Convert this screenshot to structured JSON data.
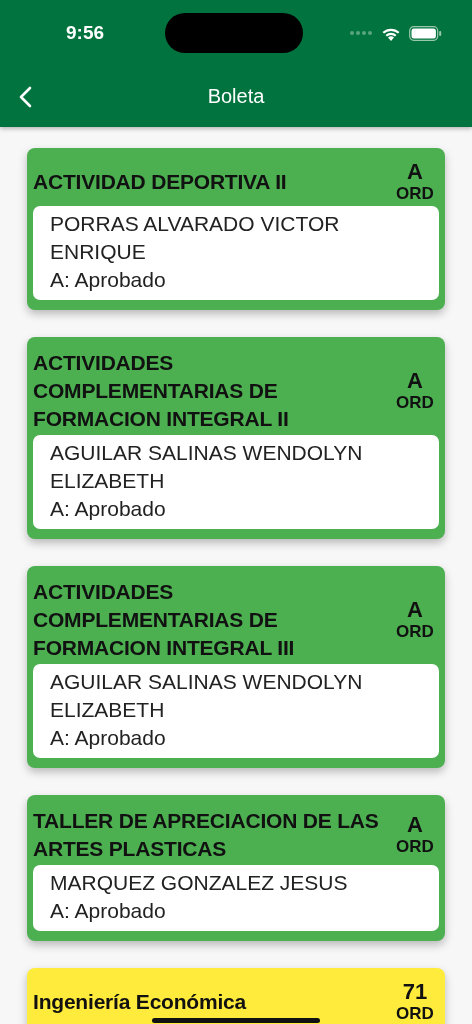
{
  "status_bar": {
    "time": "9:56"
  },
  "nav": {
    "title": "Boleta"
  },
  "courses": [
    {
      "title": "ACTIVIDAD DEPORTIVA II",
      "grade": "A",
      "type": "ORD",
      "color": "#4caf50",
      "teacher": "PORRAS ALVARADO VICTOR ENRIQUE",
      "result": "A: Aprobado"
    },
    {
      "title": "ACTIVIDADES COMPLEMENTARIAS DE FORMACION INTEGRAL II",
      "grade": "A",
      "type": "ORD",
      "color": "#4caf50",
      "teacher": "AGUILAR SALINAS WENDOLYN ELIZABETH",
      "result": "A: Aprobado"
    },
    {
      "title": "ACTIVIDADES COMPLEMENTARIAS DE FORMACION INTEGRAL III",
      "grade": "A",
      "type": "ORD",
      "color": "#4caf50",
      "teacher": "AGUILAR SALINAS WENDOLYN ELIZABETH",
      "result": "A: Aprobado"
    },
    {
      "title": "TALLER DE APRECIACION DE LAS ARTES PLASTICAS",
      "grade": "A",
      "type": "ORD",
      "color": "#4caf50",
      "teacher": "MARQUEZ GONZALEZ JESUS",
      "result": "A: Aprobado"
    },
    {
      "title": "Ingeniería Económica",
      "grade": "71",
      "type": "ORD",
      "color": "#ffeb3b"
    }
  ]
}
